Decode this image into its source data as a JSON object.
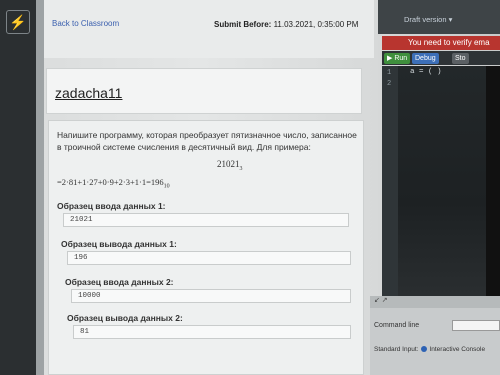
{
  "sidebar": {
    "icon": "lightning-icon"
  },
  "header": {
    "back_link": "Back to Classroom",
    "submit_label": "Submit Before:",
    "submit_value": " 11.03.2021, 0:35:00 PM"
  },
  "task": {
    "title": "zadacha11",
    "description": "Напишите программу, которая преобразует пятизначное число, записанное в троичной системе счисления в десятичный вид. Для примера:",
    "example_number": "21021",
    "example_base": "3",
    "formula": "=2·81+1·27+0·9+2·3+1·1=196",
    "formula_base": "10",
    "samples": [
      {
        "label": "Образец ввода данных 1:",
        "value": "21021"
      },
      {
        "label": "Образец вывода данных 1:",
        "value": "196"
      },
      {
        "label": "Образец ввода данных 2:",
        "value": "10000"
      },
      {
        "label": "Образец вывода данных 2:",
        "value": "81"
      }
    ]
  },
  "editor": {
    "draft_version": "Draft version ▾",
    "verify_notice": "You need to verify ema",
    "run_label": "▶ Run",
    "debug_label": "Debug",
    "stop_label": "Sto",
    "line_numbers": [
      "1",
      "2"
    ],
    "code_line1": "a  =  (       )",
    "collapse_icon": "↙  ↗",
    "command_line_label": "Command line",
    "standard_input_label": "Standard Input:",
    "interactive_console": "Interactive Console"
  },
  "colors": {
    "accent": "#3a5fae",
    "run": "#3f8f3d",
    "debug": "#3c6fb8",
    "alert": "#b8352f"
  }
}
